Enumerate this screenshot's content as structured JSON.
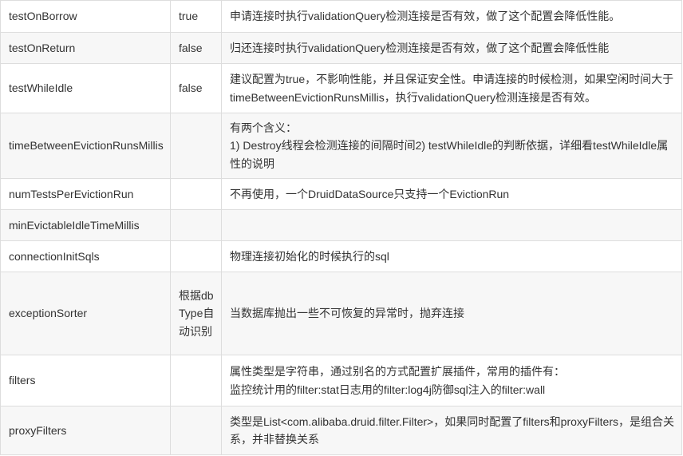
{
  "rows": [
    {
      "name": "testOnBorrow",
      "default": "true",
      "desc": [
        "申请连接时执行validationQuery检测连接是否有效，做了这个配置会降低性能。"
      ]
    },
    {
      "name": "testOnReturn",
      "default": "false",
      "desc": [
        "归还连接时执行validationQuery检测连接是否有效，做了这个配置会降低性能"
      ]
    },
    {
      "name": "testWhileIdle",
      "default": "false",
      "desc": [
        "建议配置为true，不影响性能，并且保证安全性。申请连接的时候检测，如果空闲时间大于timeBetweenEvictionRunsMillis，执行validationQuery检测连接是否有效。"
      ]
    },
    {
      "name": "timeBetweenEvictionRunsMillis",
      "default": "",
      "desc": [
        "有两个含义：",
        "1) Destroy线程会检测连接的间隔时间2) testWhileIdle的判断依据，详细看testWhileIdle属性的说明"
      ]
    },
    {
      "name": "numTestsPerEvictionRun",
      "default": "",
      "desc": [
        "不再使用，一个DruidDataSource只支持一个EvictionRun"
      ]
    },
    {
      "name": "minEvictableIdleTimeMillis",
      "default": "",
      "desc": [
        ""
      ]
    },
    {
      "name": "connectionInitSqls",
      "default": "",
      "desc": [
        "物理连接初始化的时候执行的sql"
      ]
    },
    {
      "name": "exceptionSorter",
      "default": "根据dbType自动识别",
      "desc": [
        "当数据库抛出一些不可恢复的异常时，抛弃连接"
      ]
    },
    {
      "name": "filters",
      "default": "",
      "desc": [
        "属性类型是字符串，通过别名的方式配置扩展插件，常用的插件有：",
        "监控统计用的filter:stat日志用的filter:log4j防御sql注入的filter:wall"
      ]
    },
    {
      "name": "proxyFilters",
      "default": "",
      "desc": [
        "类型是List<com.alibaba.druid.filter.Filter>，如果同时配置了filters和proxyFilters，是组合关系，并非替换关系"
      ]
    }
  ]
}
